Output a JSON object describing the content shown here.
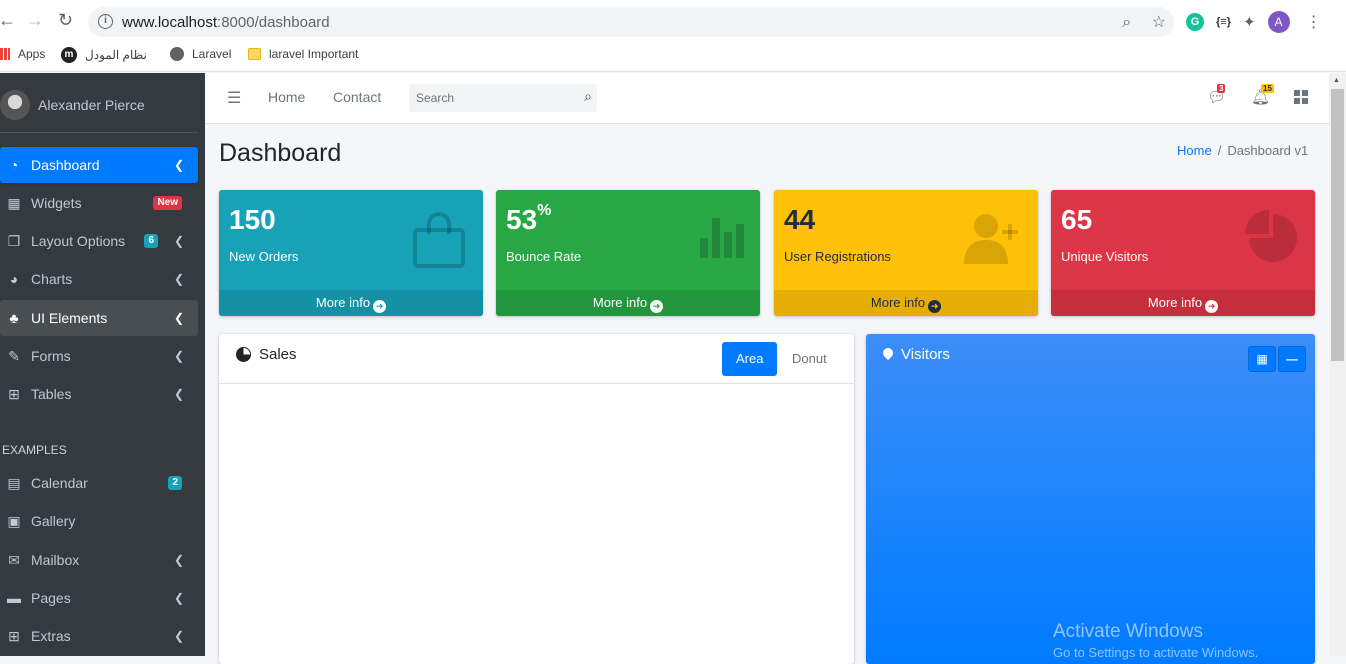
{
  "browser": {
    "url_host": "www.localhost",
    "url_rest": ":8000/dashboard",
    "bookmarks": [
      {
        "label": "Apps"
      },
      {
        "label": "نظام المودل"
      },
      {
        "label": "Laravel"
      },
      {
        "label": "laravel Important"
      }
    ],
    "profile_initial": "A",
    "ext_c": "{≡}"
  },
  "sidebar": {
    "user_name": "Alexander Pierce",
    "items": [
      {
        "label": "Dashboard",
        "icon": "dashboard-icon"
      },
      {
        "label": "Widgets",
        "icon": "widgets-icon",
        "badge": "New"
      },
      {
        "label": "Layout Options",
        "icon": "copy-icon",
        "badge": "6"
      },
      {
        "label": "Charts",
        "icon": "chart-pie-icon"
      },
      {
        "label": "UI Elements",
        "icon": "tree-icon"
      },
      {
        "label": "Forms",
        "icon": "edit-icon"
      },
      {
        "label": "Tables",
        "icon": "table-icon"
      }
    ],
    "examples_header": "EXAMPLES",
    "examples": [
      {
        "label": "Calendar",
        "icon": "calendar-icon",
        "badge": "2"
      },
      {
        "label": "Gallery",
        "icon": "image-icon"
      },
      {
        "label": "Mailbox",
        "icon": "envelope-icon"
      },
      {
        "label": "Pages",
        "icon": "book-icon"
      },
      {
        "label": "Extras",
        "icon": "plus-square-icon"
      }
    ]
  },
  "navbar": {
    "home": "Home",
    "contact": "Contact",
    "search_placeholder": "Search",
    "messages_count": "3",
    "notifications_count": "15"
  },
  "content": {
    "title": "Dashboard",
    "breadcrumb_home": "Home",
    "breadcrumb_current": "Dashboard v1",
    "boxes": [
      {
        "value": "150",
        "sup": "",
        "label": "New Orders",
        "footer": "More info",
        "color": "#17a2b8",
        "icon": "shopping-bag-icon"
      },
      {
        "value": "53",
        "sup": "%",
        "label": "Bounce Rate",
        "footer": "More info",
        "color": "#28a745",
        "icon": "stats-bars-icon"
      },
      {
        "value": "44",
        "sup": "",
        "label": "User Registrations",
        "footer": "More info",
        "color": "#ffc107",
        "icon": "person-add-icon"
      },
      {
        "value": "65",
        "sup": "",
        "label": "Unique Visitors",
        "footer": "More info",
        "color": "#dc3545",
        "icon": "pie-graph-icon"
      }
    ],
    "sales": {
      "title": "Sales",
      "tab_area": "Area",
      "tab_donut": "Donut"
    },
    "visitors": {
      "title": "Visitors"
    }
  },
  "watermark": {
    "line1": "Activate Windows",
    "line2": "Go to Settings to activate Windows."
  }
}
